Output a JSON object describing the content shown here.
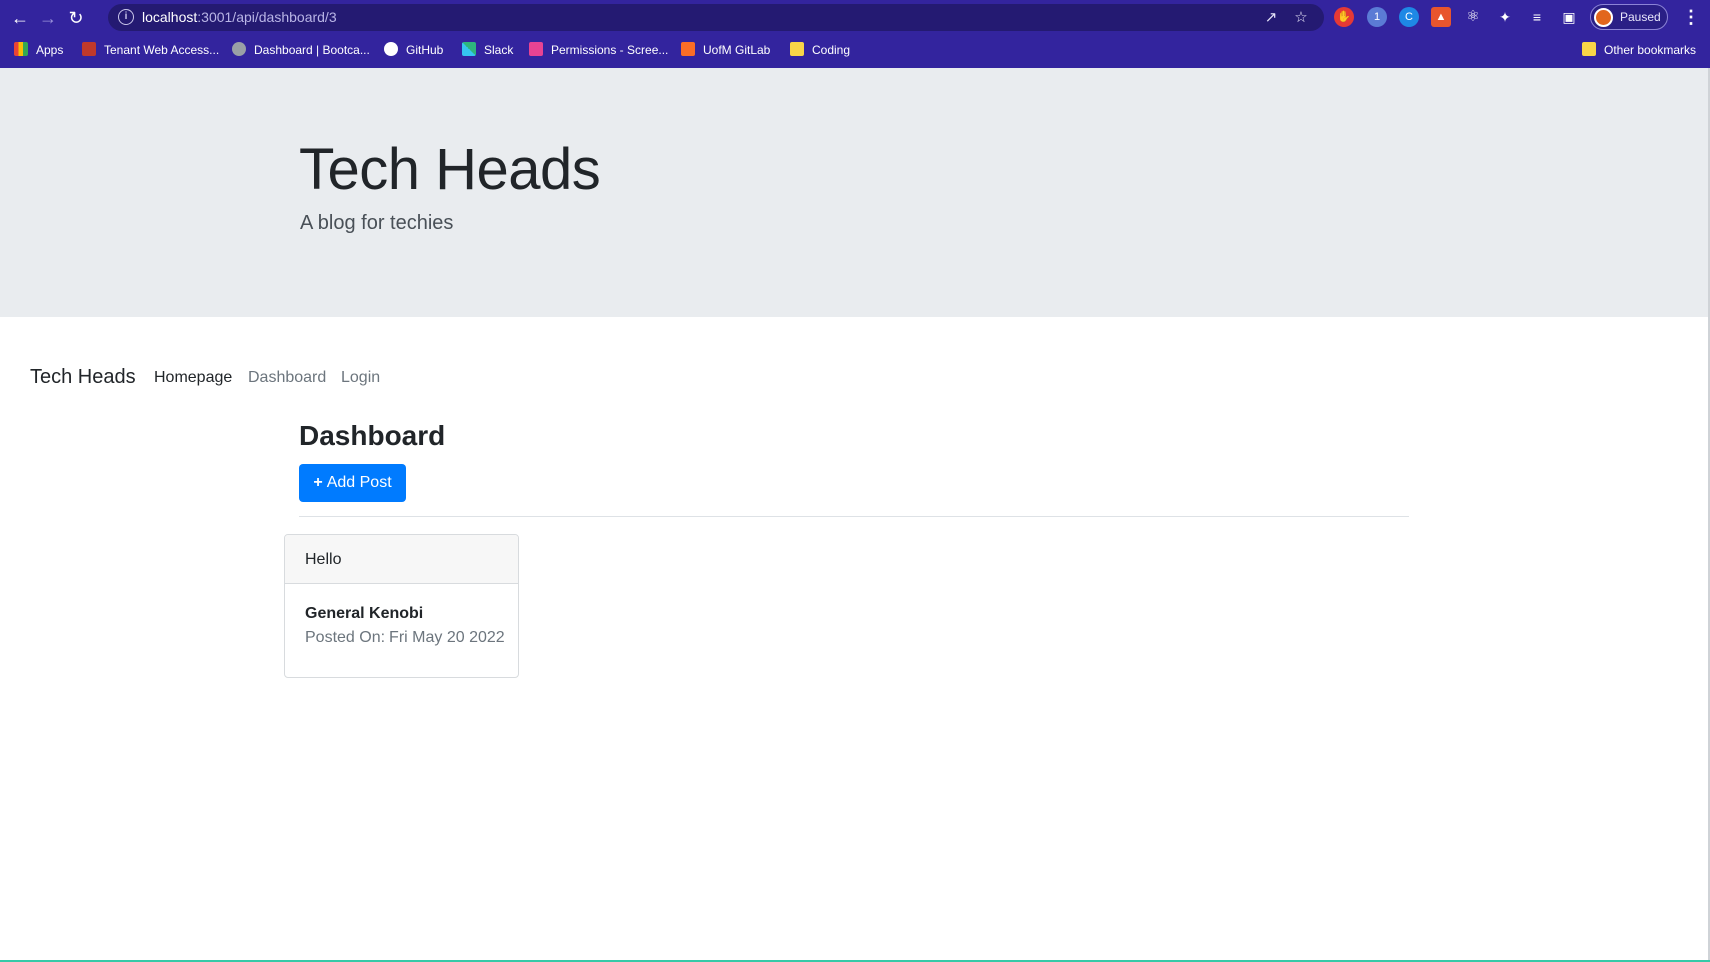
{
  "browser": {
    "url_host": "localhost",
    "url_path": ":3001/api/dashboard/3",
    "profile_status": "Paused",
    "extension_badge": "1",
    "bookmarks": [
      {
        "label": "Apps",
        "icon": "apps-grid-icon",
        "color": "#4285f4"
      },
      {
        "label": "Tenant Web Access...",
        "icon": "building-icon",
        "color": "#c0392b"
      },
      {
        "label": "Dashboard | Bootca...",
        "icon": "globe-icon",
        "color": "#9aa0a6"
      },
      {
        "label": "GitHub",
        "icon": "github-icon",
        "color": "#ffffff"
      },
      {
        "label": "Slack",
        "icon": "slack-icon",
        "color": "#36c5f0"
      },
      {
        "label": "Permissions - Scree...",
        "icon": "permissions-icon",
        "color": "#e84393"
      },
      {
        "label": "UofM GitLab",
        "icon": "gitlab-icon",
        "color": "#fc6d26"
      },
      {
        "label": "Coding",
        "icon": "folder-icon",
        "color": "#f9d548"
      }
    ],
    "other_bookmarks": {
      "label": "Other bookmarks",
      "icon": "folder-icon",
      "color": "#f9d548"
    }
  },
  "jumbotron": {
    "title": "Tech Heads",
    "subtitle": "A blog for techies"
  },
  "navbar": {
    "brand": "Tech Heads",
    "links": [
      {
        "label": "Homepage",
        "active": true
      },
      {
        "label": "Dashboard",
        "active": false
      },
      {
        "label": "Login",
        "active": false
      }
    ]
  },
  "main": {
    "heading": "Dashboard",
    "add_post_label": "Add Post",
    "add_post_icon": "plus-icon",
    "posts": [
      {
        "header": "Hello",
        "title": "General Kenobi",
        "posted_on_label": "Posted On:",
        "date": "Fri May 20 2022"
      }
    ]
  },
  "colors": {
    "chrome_bg": "#33249e",
    "jumbotron_bg": "#e9ecef",
    "primary": "#007bff"
  }
}
